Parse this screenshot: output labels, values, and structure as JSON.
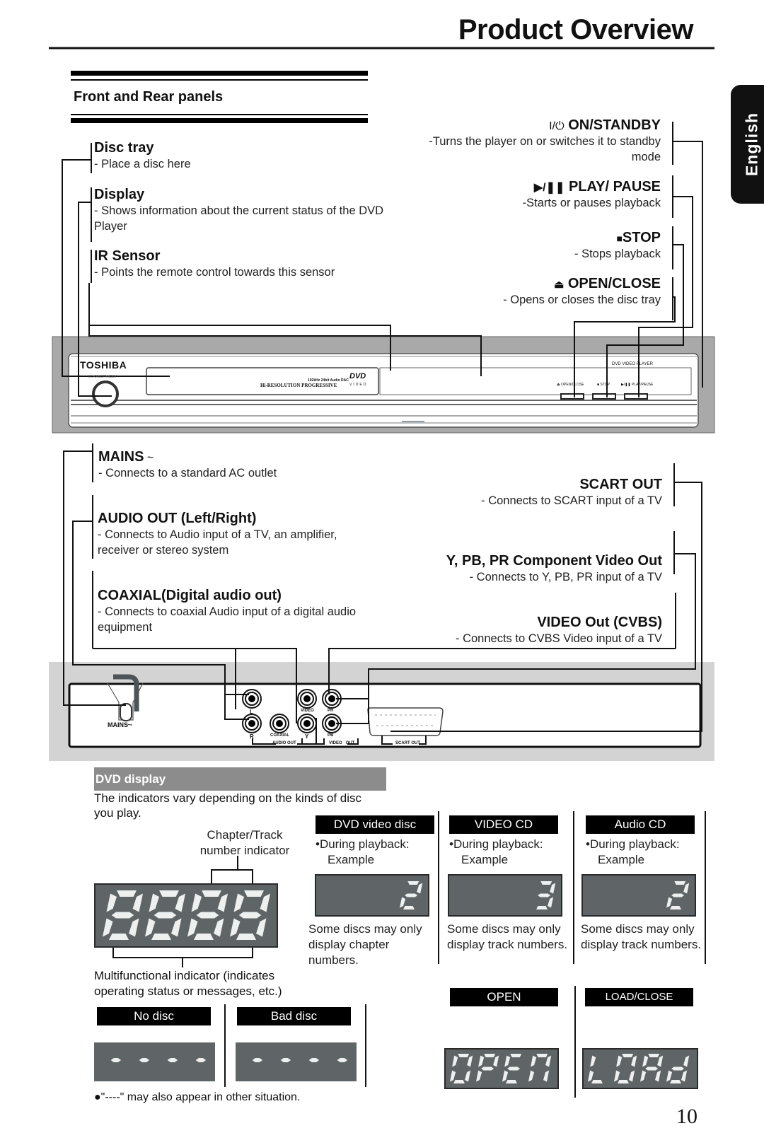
{
  "page": {
    "title": "Product Overview",
    "section_title": "Front and Rear panels",
    "language_tab": "English",
    "page_number": "10"
  },
  "front_panel": {
    "left_callouts": [
      {
        "title": "Disc tray",
        "desc": "- Place a disc here"
      },
      {
        "title": "Display",
        "desc": "- Shows information about the current status of the DVD Player"
      },
      {
        "title": "IR Sensor",
        "desc": "- Points the remote control towards this sensor"
      }
    ],
    "right_callouts": [
      {
        "icon": "I/⏻",
        "title": "ON/STANDBY",
        "desc": "-Turns the player on or switches it to standby mode"
      },
      {
        "icon": "▶/❚❚",
        "title": "PLAY/ PAUSE",
        "desc": "-Starts or pauses playback"
      },
      {
        "icon": "■",
        "title": "STOP",
        "desc": "- Stops playback"
      },
      {
        "icon": "⏏",
        "title": "OPEN/CLOSE",
        "desc": "- Opens or closes the disc tray"
      }
    ],
    "device": {
      "brand": "TOSHIBA",
      "power_label": "I/⏻ ON/STANDBY",
      "dac_label": "192kHz 24bit Audio DAC",
      "progressive_label": "Hi-RESOLUTION PROGRESSIVE",
      "dvd_logo": "DVD",
      "dvd_logo_sub": "VIDEO",
      "model_label": "DVD VIDEO PLAYER",
      "button_labels": [
        "⏏ OPEN/CLOSE",
        "■ STOP",
        "▶/❚❚ PLAY/PAUSE"
      ]
    }
  },
  "rear_panel": {
    "left_callouts": [
      {
        "title": "MAINS",
        "suffix": " ~",
        "desc": "- Connects to a standard AC outlet"
      },
      {
        "title": "AUDIO OUT (Left/Right)",
        "desc": "- Connects to Audio input of a TV, an amplifier, receiver or stereo system"
      },
      {
        "title": "COAXIAL(Digital audio out)",
        "desc": "- Connects to coaxial Audio input of a digital audio equipment"
      }
    ],
    "right_callouts": [
      {
        "title": "SCART OUT",
        "desc": "- Connects to SCART input of a TV"
      },
      {
        "title": "Y, PB, PR Component Video Out",
        "desc": "- Connects to Y, PB, PR input of a TV"
      },
      {
        "title": "VIDEO Out (CVBS)",
        "desc": "- Connects to CVBS  Video input  of a TV"
      }
    ],
    "device": {
      "mains_label": "MAINS",
      "jack_labels": {
        "L": "L",
        "R": "R",
        "coaxial": "COAXIAL",
        "video": "VIDEO",
        "y": "Y",
        "pb": "PB",
        "pr": "PR"
      },
      "group_labels": {
        "audio_out": "AUDIO OUT",
        "video_out": "VIDEO   OUT",
        "scart_out": "SCART OUT"
      }
    }
  },
  "dvd_display": {
    "header": "DVD display",
    "intro": "The indicators vary depending on the kinds of disc you play.",
    "chapter_track_label": "Chapter/Track number indicator",
    "multifunctional_label": "Multifunctional indicator (indicates operating status or messages, etc.)",
    "full_display": "8888",
    "disc_types": [
      {
        "label": "DVD video disc",
        "during": "•During playback:",
        "example": "Example",
        "display": "2",
        "note": "Some discs may only display chapter numbers."
      },
      {
        "label": "VIDEO CD",
        "during": "•During playback:",
        "example": "Example",
        "display": "3",
        "note": "Some discs may only display track numbers."
      },
      {
        "label": "Audio CD",
        "during": "•During playback:",
        "example": "Example",
        "display": "2",
        "note": "Some discs may only display track numbers."
      }
    ],
    "status_messages": [
      {
        "label": "No disc",
        "display": "----"
      },
      {
        "label": "Bad disc",
        "display": "----"
      },
      {
        "label": "OPEN",
        "display": "OPEN"
      },
      {
        "label": "LOAD/CLOSE",
        "display": "LOAd"
      }
    ],
    "footnote": "●\"----\" may also appear in other situation."
  }
}
